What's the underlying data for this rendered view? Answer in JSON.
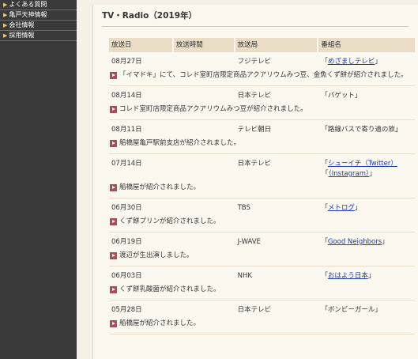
{
  "sidebar": {
    "items": [
      {
        "label": "よくある質問"
      },
      {
        "label": "亀戸天神情報"
      },
      {
        "label": "会社情報"
      },
      {
        "label": "採用情報"
      }
    ]
  },
  "main": {
    "title": "TV・Radio（2019年）",
    "columns": [
      "放送日",
      "放送時間",
      "放送局",
      "番組名"
    ],
    "rows": [
      {
        "date": "08月27日",
        "time": "",
        "station": "フジテレビ",
        "program_prefix": "「",
        "program": "めざましテレビ",
        "program_suffix": "」",
        "program_link": true,
        "desc": "「イマドキ」にて、コレド室町店限定商品アクアリウムみつ豆、金魚くず餅が紹介されました。"
      },
      {
        "date": "08月14日",
        "time": "",
        "station": "日本テレビ",
        "program_prefix": "",
        "program": "「バゲット」",
        "program_suffix": "",
        "program_link": false,
        "desc": "コレド室町店限定商品アクアリウムみつ豆が紹介されました。"
      },
      {
        "date": "08月11日",
        "time": "",
        "station": "テレビ朝日",
        "program_prefix": "",
        "program": "「路線バスで寄り道の旅」",
        "program_suffix": "",
        "program_link": false,
        "desc": "船橋屋亀戸駅前支店が紹介されました。"
      },
      {
        "date": "07月14日",
        "time": "",
        "station": "日本テレビ",
        "program_prefix": "「",
        "program": "シューイチ（Twitter）",
        "program_suffix": "",
        "program_link": true,
        "program_line2_prefix": "「",
        "program_line2": "（Instagram）",
        "program_line2_suffix": "」",
        "desc": "船橋屋が紹介されました。"
      },
      {
        "date": "06月30日",
        "time": "",
        "station": "TBS",
        "program_prefix": "「",
        "program": "メトログ",
        "program_suffix": "」",
        "program_link": true,
        "desc": "くず餅プリンが紹介されました。"
      },
      {
        "date": "06月19日",
        "time": "",
        "station": "J-WAVE",
        "program_prefix": "「",
        "program": "Good Neighbors",
        "program_suffix": "」",
        "program_link": true,
        "desc": "渡辺が生出演しました。"
      },
      {
        "date": "06月03日",
        "time": "",
        "station": "NHK",
        "program_prefix": "「",
        "program": "おはよう日本",
        "program_suffix": "」",
        "program_link": true,
        "desc": "くず餅乳酸菌が紹介されました。"
      },
      {
        "date": "05月28日",
        "time": "",
        "station": "日本テレビ",
        "program_prefix": "",
        "program": "「ボンビーガール」",
        "program_suffix": "",
        "program_link": false,
        "desc": "船橋屋が紹介されました。"
      }
    ]
  },
  "colors": {
    "sidebar_bg": "#3a3a3a",
    "header_cell_bg": "#e9ddc6",
    "link": "#1a3aa8",
    "bullet": "#b04a5a"
  },
  "icons": {
    "sidebar_arrow": "triangle-right-icon",
    "desc_bullet": "play-bullet-icon"
  }
}
